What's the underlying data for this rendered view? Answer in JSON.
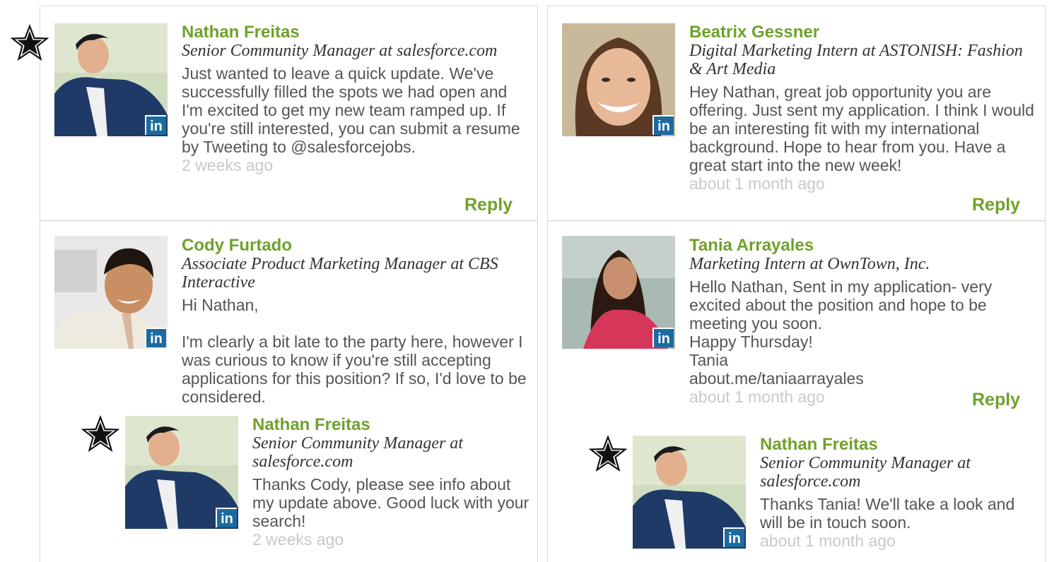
{
  "posts": [
    {
      "name": "Nathan Freitas",
      "title": "Senior Community Manager at salesforce.com",
      "body": "Just wanted to leave a quick update. We've successfully filled the spots we had open and I'm excited to get my new team ramped up. If you're still interested, you can submit a resume by Tweeting to @salesforcejobs.",
      "time": "2 weeks ago",
      "reply_label": "Reply",
      "badge": "in",
      "starred": true
    },
    {
      "name": "Beatrix Gessner",
      "title": "Digital Marketing Intern at ASTONISH: Fashion & Art Media",
      "body": "Hey Nathan, great job opportunity you are offering. Just sent my application. I think I would be an interesting fit with my international background. Hope to hear from you. Have a great start into the new week!",
      "time": "about 1 month ago",
      "reply_label": "Reply",
      "badge": "in"
    },
    {
      "name": "Cody Furtado",
      "title": "Associate Product Marketing Manager at CBS Interactive",
      "body": "Hi Nathan,\n\nI'm clearly a bit late to the party here, however I was curious to know if you're still accepting applications for this position? If so, I'd love to be considered.",
      "badge": "in"
    },
    {
      "name": "Tania Arrayales",
      "title": "Marketing Intern at OwnTown, Inc.",
      "body": "Hello Nathan, Sent in my application- very excited about the position and hope to be meeting you soon.\nHappy Thursday!\nTania\nabout.me/taniaarrayales",
      "time": "about 1 month ago",
      "reply_label": "Reply",
      "badge": "in"
    }
  ],
  "replies": [
    {
      "name": "Nathan Freitas",
      "title": "Senior Community Manager at salesforce.com",
      "body": "Thanks Cody, please see info about my update above. Good luck with your search!",
      "time": "2 weeks ago",
      "badge": "in",
      "starred": true
    },
    {
      "name": "Nathan Freitas",
      "title": "Senior Community Manager at salesforce.com",
      "body": "Thanks Tania! We'll take a look and will be in touch soon.",
      "time": "about 1 month ago",
      "badge": "in",
      "starred": true
    }
  ],
  "colors": {
    "name_green": "#6fa12b",
    "linkedin_blue": "#1b6aa0",
    "time_gray": "#c9c9c9"
  },
  "icons": {
    "star": "star-icon",
    "linkedin": "linkedin-badge-icon"
  }
}
